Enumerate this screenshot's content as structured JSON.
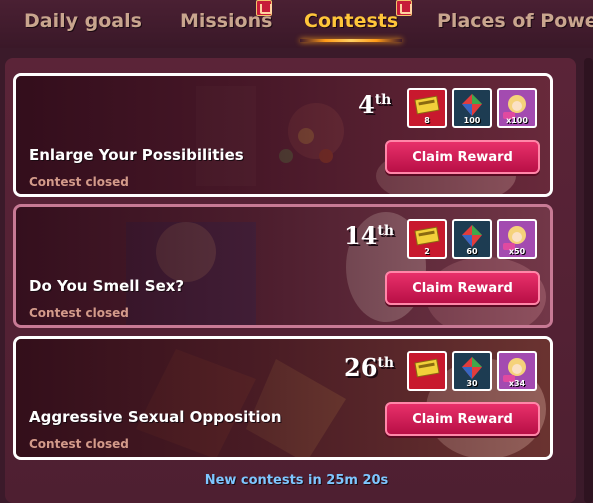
{
  "tabs": [
    {
      "label": "Daily goals"
    },
    {
      "label": "Missions"
    },
    {
      "label": "Contests"
    },
    {
      "label": "Places of Power"
    }
  ],
  "contests": [
    {
      "title": "Enlarge Your Possibilities",
      "status": "Contest closed",
      "rank_number": "4",
      "rank_suffix": "th",
      "button": "Claim Reward",
      "rewards": [
        {
          "icon": "kobans-icon",
          "amount": "8"
        },
        {
          "icon": "gems-icon",
          "amount": "100"
        },
        {
          "icon": "avatar-icon",
          "amount": "x100"
        }
      ]
    },
    {
      "title": "Do You Smell Sex?",
      "status": "Contest closed",
      "rank_number": "14",
      "rank_suffix": "th",
      "button": "Claim Reward",
      "rewards": [
        {
          "icon": "kobans-icon",
          "amount": "2"
        },
        {
          "icon": "gems-icon",
          "amount": "60"
        },
        {
          "icon": "avatar-icon",
          "amount": "x50"
        }
      ]
    },
    {
      "title": "Aggressive Sexual Opposition",
      "status": "Contest closed",
      "rank_number": "26",
      "rank_suffix": "th",
      "button": "Claim Reward",
      "rewards": [
        {
          "icon": "kobans-icon",
          "amount": ""
        },
        {
          "icon": "gems-icon",
          "amount": "30"
        },
        {
          "icon": "avatar-icon",
          "amount": "x34"
        }
      ]
    }
  ],
  "footer": "New contests in 25m 20s",
  "colors": {
    "active_tab": "#ffc63a",
    "inactive_tab": "#c9a58e",
    "claim_button": "#d81e5b",
    "footer_text": "#7ec6ff"
  }
}
